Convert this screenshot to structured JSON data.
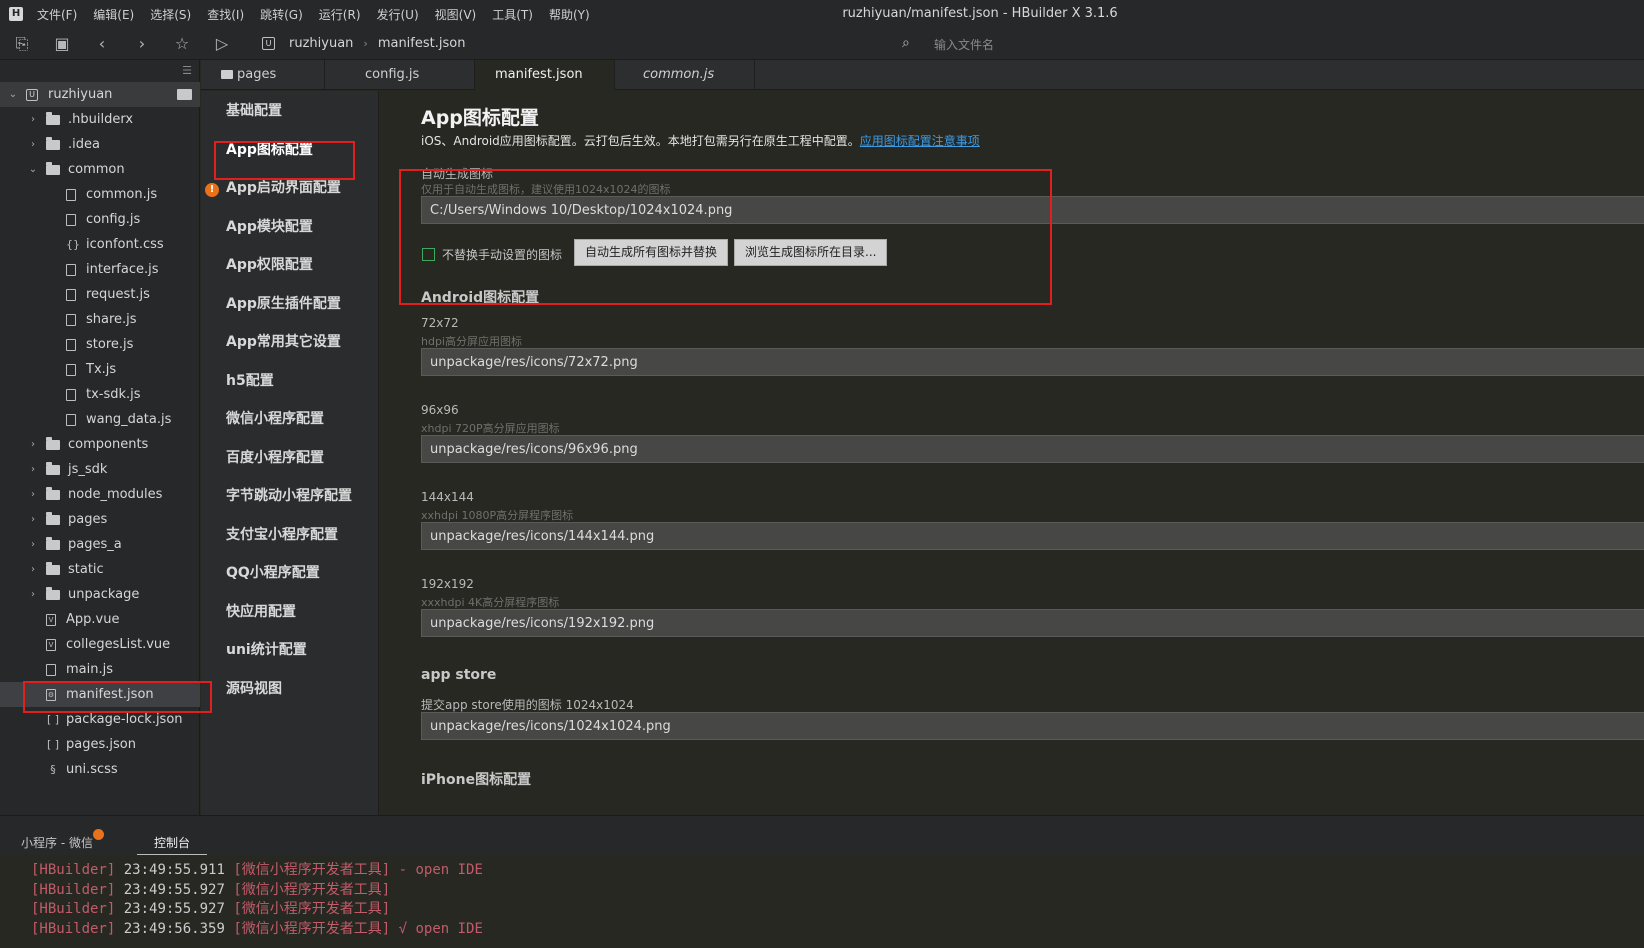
{
  "window": {
    "title": "ruzhiyuan/manifest.json - HBuilder X 3.1.6"
  },
  "menu": [
    "文件(F)",
    "编辑(E)",
    "选择(S)",
    "查找(I)",
    "跳转(G)",
    "运行(R)",
    "发行(U)",
    "视图(V)",
    "工具(T)",
    "帮助(Y)"
  ],
  "toolbar": {
    "breadcrumb": [
      "ruzhiyuan",
      "manifest.json"
    ],
    "file_search_placeholder": "输入文件名"
  },
  "tree": {
    "project": "ruzhiyuan",
    "items": [
      {
        "label": ".hbuilderx",
        "kind": "folder",
        "depth": 1,
        "expanded": false
      },
      {
        "label": ".idea",
        "kind": "folder",
        "depth": 1,
        "expanded": false
      },
      {
        "label": "common",
        "kind": "folder",
        "depth": 1,
        "expanded": true
      },
      {
        "label": "common.js",
        "kind": "file",
        "depth": 2
      },
      {
        "label": "config.js",
        "kind": "file",
        "depth": 2
      },
      {
        "label": "iconfont.css",
        "kind": "css",
        "depth": 2
      },
      {
        "label": "interface.js",
        "kind": "file",
        "depth": 2
      },
      {
        "label": "request.js",
        "kind": "file",
        "depth": 2
      },
      {
        "label": "share.js",
        "kind": "file",
        "depth": 2
      },
      {
        "label": "store.js",
        "kind": "file",
        "depth": 2
      },
      {
        "label": "Tx.js",
        "kind": "file",
        "depth": 2
      },
      {
        "label": "tx-sdk.js",
        "kind": "file",
        "depth": 2
      },
      {
        "label": "wang_data.js",
        "kind": "file",
        "depth": 2
      },
      {
        "label": "components",
        "kind": "folder",
        "depth": 1,
        "expanded": false
      },
      {
        "label": "js_sdk",
        "kind": "folder",
        "depth": 1,
        "expanded": false
      },
      {
        "label": "node_modules",
        "kind": "folder",
        "depth": 1,
        "expanded": false
      },
      {
        "label": "pages",
        "kind": "folder",
        "depth": 1,
        "expanded": false
      },
      {
        "label": "pages_a",
        "kind": "folder",
        "depth": 1,
        "expanded": false
      },
      {
        "label": "static",
        "kind": "folder",
        "depth": 1,
        "expanded": false
      },
      {
        "label": "unpackage",
        "kind": "folder",
        "depth": 1,
        "expanded": false
      },
      {
        "label": "App.vue",
        "kind": "vue",
        "depth": 1
      },
      {
        "label": "collegesList.vue",
        "kind": "vue",
        "depth": 1
      },
      {
        "label": "main.js",
        "kind": "file",
        "depth": 1
      },
      {
        "label": "manifest.json",
        "kind": "manifest",
        "depth": 1,
        "selected": true
      },
      {
        "label": "package-lock.json",
        "kind": "json",
        "depth": 1
      },
      {
        "label": "pages.json",
        "kind": "json",
        "depth": 1
      },
      {
        "label": "uni.scss",
        "kind": "scss",
        "depth": 1
      }
    ]
  },
  "tabs": [
    {
      "label": "pages",
      "folder": true
    },
    {
      "label": "config.js"
    },
    {
      "label": "manifest.json",
      "active": true
    },
    {
      "label": "common.js",
      "italic": true
    }
  ],
  "manifest_nav": [
    "基础配置",
    "App图标配置",
    "App启动界面配置",
    "App模块配置",
    "App权限配置",
    "App原生插件配置",
    "App常用其它设置",
    "h5配置",
    "微信小程序配置",
    "百度小程序配置",
    "字节跳动小程序配置",
    "支付宝小程序配置",
    "QQ小程序配置",
    "快应用配置",
    "uni统计配置",
    "源码视图"
  ],
  "content": {
    "title": "App图标配置",
    "desc": "iOS、Android应用图标配置。云打包后生效。本地打包需另行在原生工程中配置。",
    "desc_link": "应用图标配置注意事项",
    "auto": {
      "label": "自动生成图标",
      "hint": "仅用于自动生成图标，建议使用1024x1024的图标",
      "value": "C:/Users/Windows 10/Desktop/1024x1024.png",
      "checkbox_label": "不替换手动设置的图标",
      "checkbox_checked": false,
      "btn_generate": "自动生成所有图标并替换",
      "btn_browse": "浏览生成图标所在目录..."
    },
    "android_title": "Android图标配置",
    "android": [
      {
        "label": "72x72",
        "hint": "hdpi高分屏应用图标",
        "value": "unpackage/res/icons/72x72.png"
      },
      {
        "label": "96x96",
        "hint": "xhdpi 720P高分屏应用图标",
        "value": "unpackage/res/icons/96x96.png"
      },
      {
        "label": "144x144",
        "hint": "xxhdpi 1080P高分屏程序图标",
        "value": "unpackage/res/icons/144x144.png"
      },
      {
        "label": "192x192",
        "hint": "xxxhdpi 4K高分屏程序图标",
        "value": "unpackage/res/icons/192x192.png"
      }
    ],
    "appstore_title": "app store",
    "appstore_label": "提交app store使用的图标 1024x1024",
    "appstore_value": "unpackage/res/icons/1024x1024.png",
    "iphone_title": "iPhone图标配置"
  },
  "console": {
    "tabs": [
      "小程序 - 微信",
      "控制台"
    ],
    "lines": [
      {
        "tag": "[HBuilder]",
        "time": "23:49:55.911",
        "msg": "[微信小程序开发者工具] - open IDE"
      },
      {
        "tag": "[HBuilder]",
        "time": "23:49:55.927",
        "msg": "[微信小程序开发者工具]"
      },
      {
        "tag": "[HBuilder]",
        "time": "23:49:55.927",
        "msg": "[微信小程序开发者工具]"
      },
      {
        "tag": "[HBuilder]",
        "time": "23:49:56.359",
        "msg": "[微信小程序开发者工具] √ open IDE"
      }
    ]
  },
  "colors": {
    "highlight": "#e11f1f",
    "link": "#3c9be6",
    "warning": "#e8711a"
  }
}
